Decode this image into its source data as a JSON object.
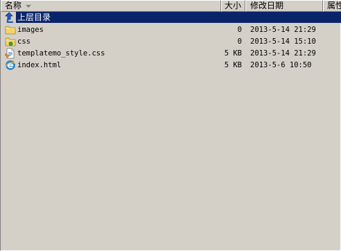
{
  "columns": {
    "name": "名称",
    "size": "大小",
    "modified": "修改日期",
    "attributes": "属性"
  },
  "up_item": {
    "label": "上层目录",
    "icon": "up-arrow-icon"
  },
  "rows": [
    {
      "name": "images",
      "size": "0",
      "modified": "2013-5-14 21:29",
      "icon": "folder-icon"
    },
    {
      "name": "css",
      "size": "0",
      "modified": "2013-5-14 15:10",
      "icon": "folder-icon"
    },
    {
      "name": "templatemo_style.css",
      "size": "5 KB",
      "modified": "2013-5-14 21:29",
      "icon": "css-file-icon"
    },
    {
      "name": "index.html",
      "size": "5 KB",
      "modified": "2013-5-6 10:50",
      "icon": "html-file-icon"
    }
  ],
  "colors": {
    "selection": "#0a246a",
    "background": "#d4d0c8"
  }
}
